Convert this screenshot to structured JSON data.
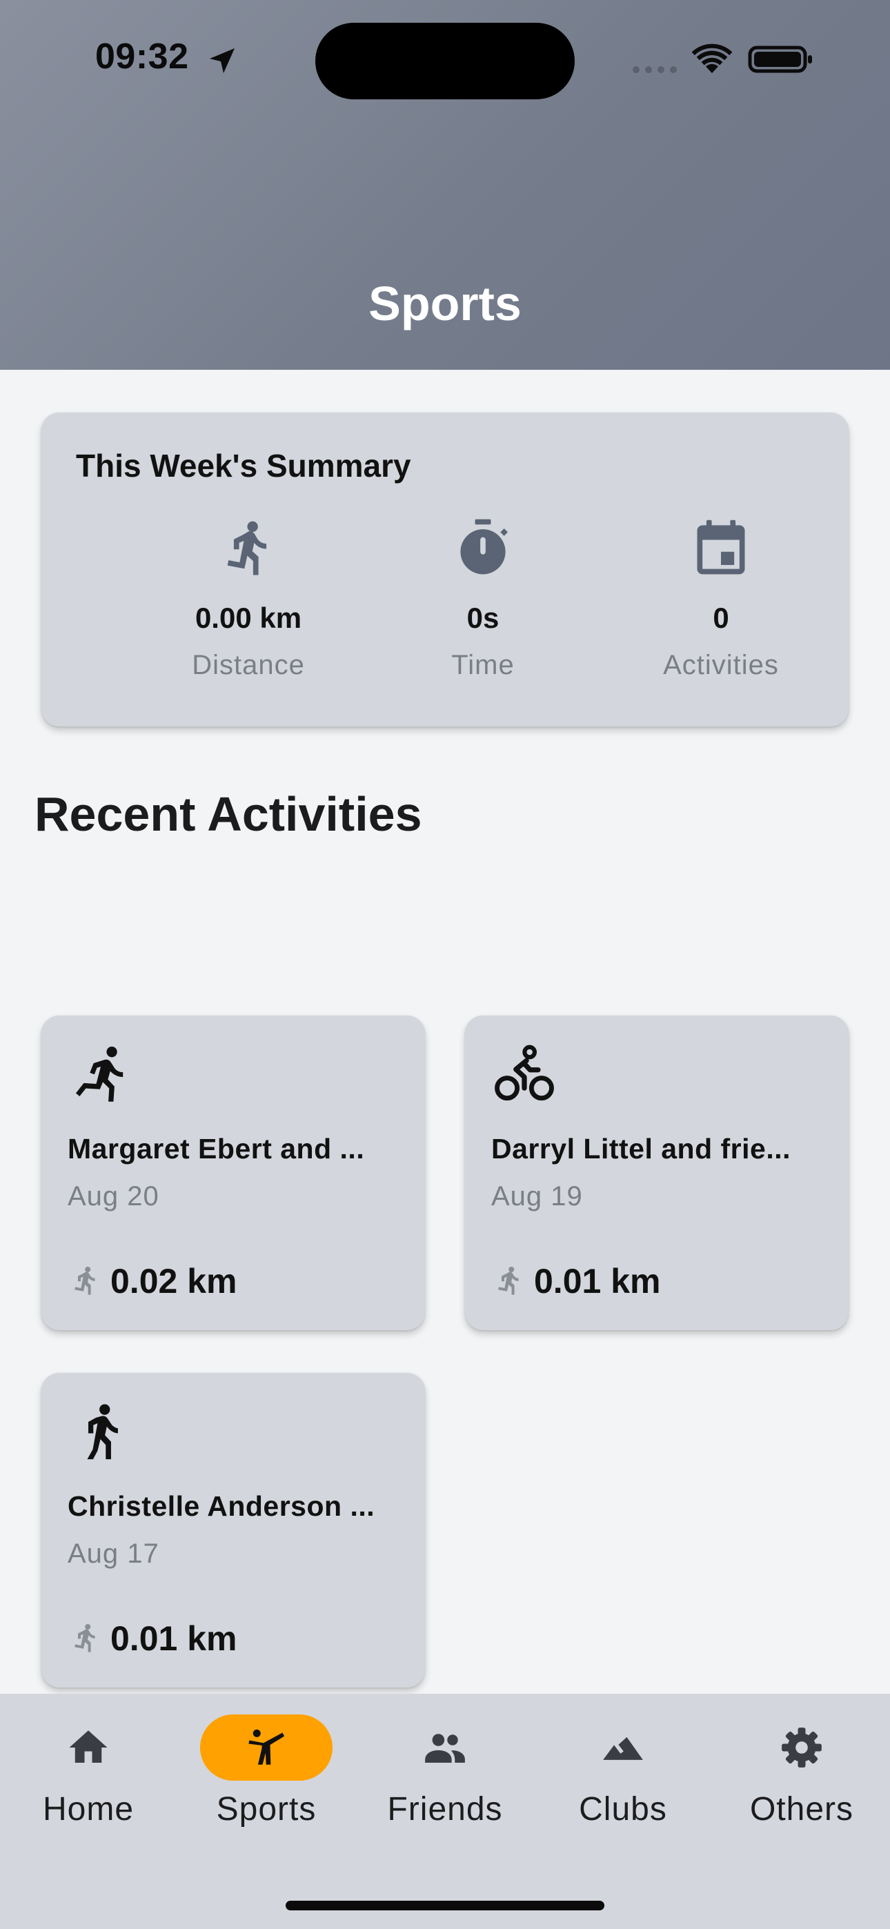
{
  "status_bar": {
    "time": "09:32"
  },
  "header": {
    "title": "Sports"
  },
  "summary": {
    "title": "This Week's Summary",
    "stats": [
      {
        "icon": "running-person-icon",
        "value": "0.00 km",
        "label": "Distance"
      },
      {
        "icon": "stopwatch-icon",
        "value": "0s",
        "label": "Time"
      },
      {
        "icon": "calendar-icon",
        "value": "0",
        "label": "Activities"
      }
    ]
  },
  "recent": {
    "title": "Recent Activities",
    "activities": [
      {
        "icon": "running-icon",
        "name": "Margaret Ebert and ...",
        "date": "Aug 20",
        "distance": "0.02 km"
      },
      {
        "icon": "cycling-icon",
        "name": "Darryl Littel and frie...",
        "date": "Aug 19",
        "distance": "0.01 km"
      },
      {
        "icon": "walking-icon",
        "name": "Christelle Anderson ...",
        "date": "Aug 17",
        "distance": "0.01 km"
      }
    ]
  },
  "nav": {
    "items": [
      {
        "label": "Home",
        "icon": "home-icon",
        "active": false
      },
      {
        "label": "Sports",
        "icon": "martial-arts-icon",
        "active": true
      },
      {
        "label": "Friends",
        "icon": "people-icon",
        "active": false
      },
      {
        "label": "Clubs",
        "icon": "mountain-icon",
        "active": false
      },
      {
        "label": "Others",
        "icon": "gear-icon",
        "active": false
      }
    ],
    "active_color": "#ffa100"
  }
}
